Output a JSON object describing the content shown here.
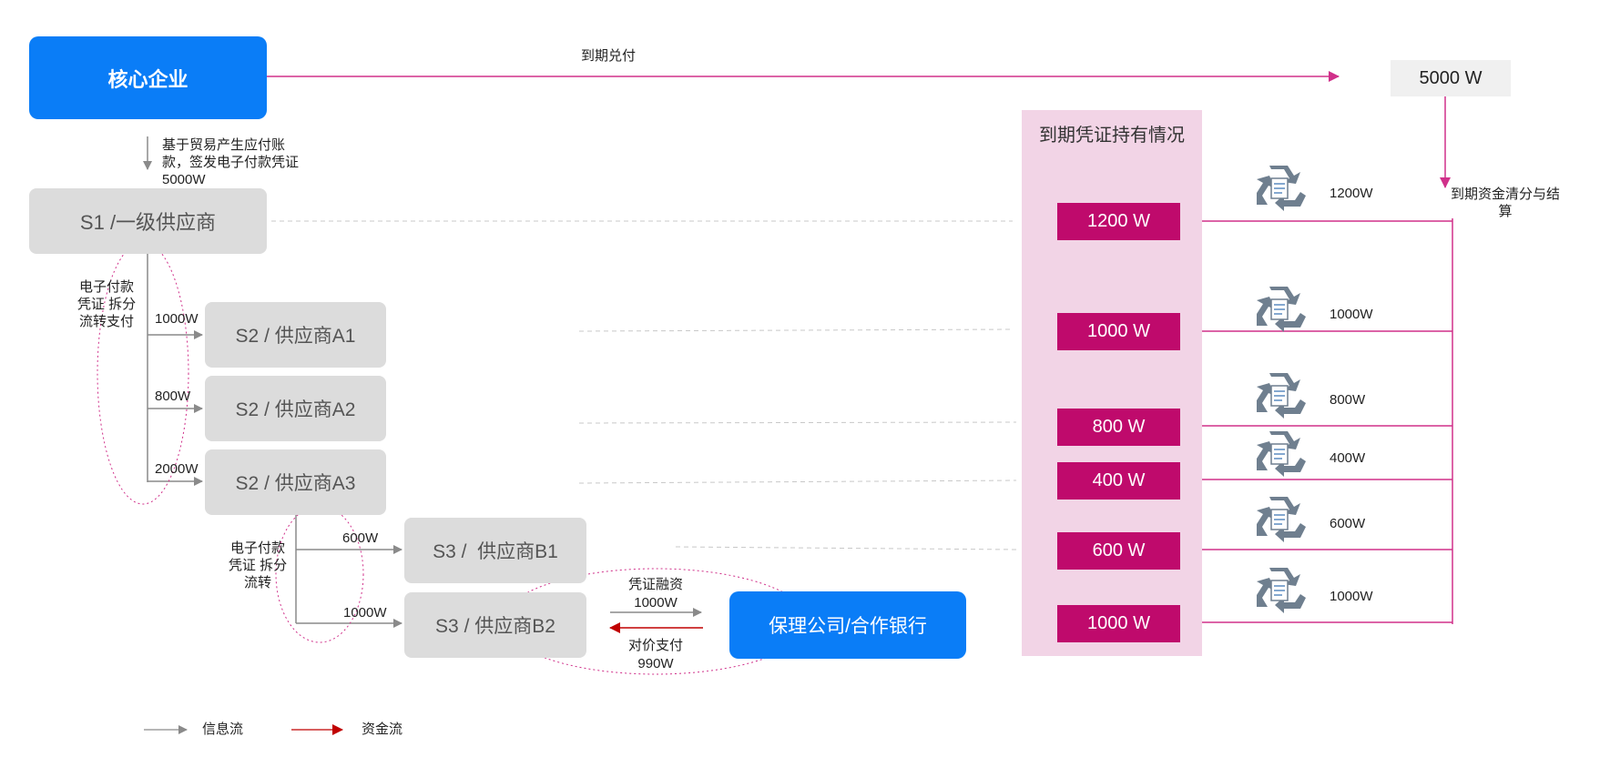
{
  "nodes": {
    "core": "核心企业",
    "total": "5000 W",
    "s1": "S1 /一级供应商",
    "a1": "S2 / 供应商A1",
    "a2": "S2 / 供应商A2",
    "a3": "S2 / 供应商A3",
    "b1": "S3 /  供应商B1",
    "b2": "S3 / 供应商B2",
    "bank": "保理公司/合作银行"
  },
  "labels": {
    "due_pay": "到期兑付",
    "issue": "基于贸易产生应付账款，签发电子付款凭证  5000W",
    "split_1": "电子付款凭证 拆分流转支付",
    "split_2": "电子付款凭证 拆分流转",
    "a1_amt": "1000W",
    "a2_amt": "800W",
    "a3_amt": "2000W",
    "b1_amt": "600W",
    "b2_amt": "1000W",
    "financing_1": "凭证融资",
    "financing_2": "1000W",
    "payment_1": "对价支付",
    "payment_2": "990W",
    "settle": "到期资金清分与结算"
  },
  "holdings": {
    "title": "到期凭证持有情况",
    "values": [
      "1200 W",
      "1000 W",
      "800 W",
      "400 W",
      "600 W",
      "1000 W"
    ],
    "amounts": [
      "1200W",
      "1000W",
      "800W",
      "400W",
      "600W",
      "1000W"
    ]
  },
  "legend": {
    "info": "信息流",
    "funds": "资金流"
  },
  "colors": {
    "blue": "#0a7df7",
    "magenta": "#bf0a6c",
    "flow_pink": "#d0308a",
    "panel": "#f2d4e6",
    "node_gray": "#dcdcdc",
    "info_gray": "#8a8a8a",
    "funds_red": "#c00000"
  },
  "icons": [
    "recycle-document-icon"
  ]
}
